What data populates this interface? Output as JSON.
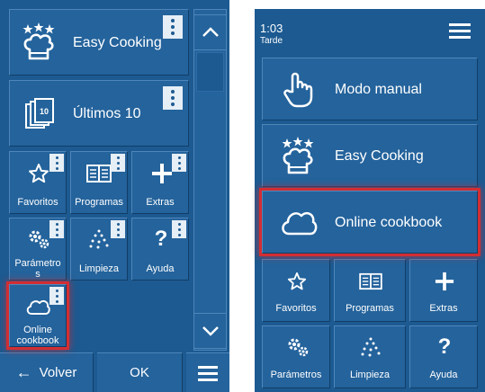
{
  "left_screen": {
    "tiles": {
      "easy_cooking": "Easy Cooking",
      "ultimos": "Últimos 10",
      "favoritos": "Favoritos",
      "programas": "Programas",
      "extras": "Extras",
      "parametros_line1": "Parámetro",
      "parametros_line2": "s",
      "limpieza": "Limpieza",
      "ayuda": "Ayuda",
      "online_line1": "Online",
      "online_line2": "cookbook"
    },
    "bottom_bar": {
      "back": "Volver",
      "ok": "OK"
    }
  },
  "right_screen": {
    "status": {
      "time": "1:03",
      "period": "Tarde"
    },
    "tiles": {
      "modo_manual": "Modo manual",
      "easy_cooking": "Easy Cooking",
      "online_cookbook": "Online cookbook",
      "favoritos": "Favoritos",
      "programas": "Programas",
      "extras": "Extras",
      "parametros": "Parámetros",
      "limpieza": "Limpieza",
      "ayuda": "Ayuda"
    }
  },
  "colors": {
    "panel": "#1c5a91",
    "tile": "#24639c",
    "highlight": "#d22e33"
  }
}
